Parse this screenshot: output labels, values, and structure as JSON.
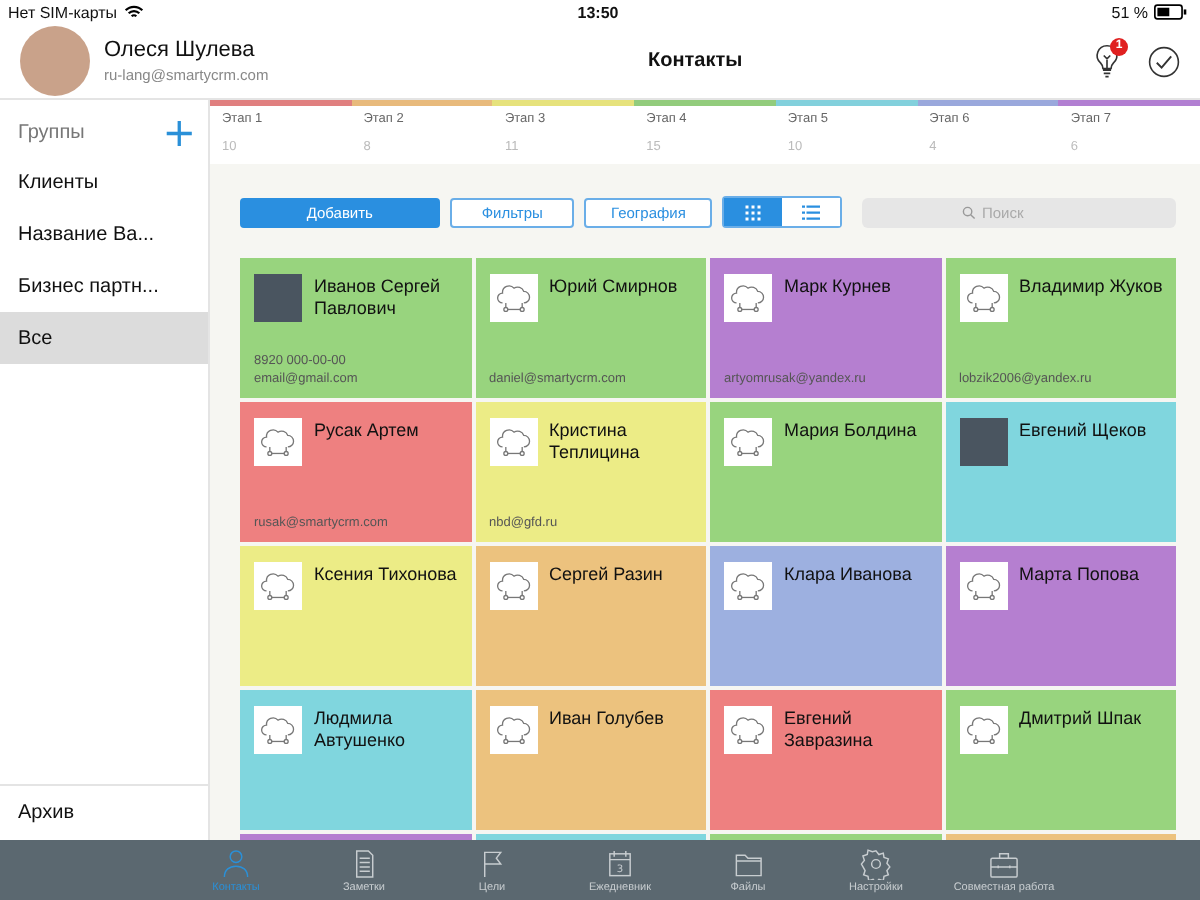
{
  "status_bar": {
    "carrier": "Нет SIM-карты",
    "time": "13:50",
    "battery": "51 %"
  },
  "header": {
    "user_name": "Олеся Шулева",
    "user_email": "ru-lang@smartycrm.com",
    "title": "Контакты",
    "notification_count": "1"
  },
  "sidebar": {
    "heading": "Группы",
    "add_label": "+",
    "items": [
      {
        "label": "Клиенты",
        "selected": false
      },
      {
        "label": "Название Ва...",
        "selected": false
      },
      {
        "label": "Бизнес партн...",
        "selected": false
      },
      {
        "label": "Все",
        "selected": true
      }
    ],
    "footer": "Архив"
  },
  "stages": [
    {
      "name": "Этап 1",
      "count": "10",
      "color": "#e07f7f"
    },
    {
      "name": "Этап 2",
      "count": "8",
      "color": "#e8ba7c"
    },
    {
      "name": "Этап 3",
      "count": "11",
      "color": "#e6e27c"
    },
    {
      "name": "Этап 4",
      "count": "15",
      "color": "#92cc7c"
    },
    {
      "name": "Этап 5",
      "count": "10",
      "color": "#82d0dc"
    },
    {
      "name": "Этап 6",
      "count": "4",
      "color": "#9aa8dc"
    },
    {
      "name": "Этап 7",
      "count": "6",
      "color": "#b27fd2"
    }
  ],
  "toolbar": {
    "add": "Добавить",
    "filters": "Фильтры",
    "geography": "География",
    "view_toggle": [
      {
        "kind": "grid",
        "selected": true
      },
      {
        "kind": "list",
        "selected": false
      }
    ],
    "search_placeholder": "Поиск"
  },
  "contacts": [
    {
      "name": "Иванов Сергей Павлович",
      "kind": "photo",
      "color": "#98d47e",
      "phone": "8920 000-00-00",
      "email": "email@gmail.com"
    },
    {
      "name": "Юрий Смирнов",
      "kind": "placeholder",
      "color": "#98d47e",
      "email": "daniel@smartycrm.com"
    },
    {
      "name": "Марк Курнев",
      "kind": "placeholder",
      "color": "#b57fd0",
      "email": "artyomrusak@yandex.ru"
    },
    {
      "name": "Владимир Жуков",
      "kind": "placeholder",
      "color": "#98d47e",
      "email": "lobzik2006@yandex.ru"
    },
    {
      "name": "Русак Артем",
      "kind": "placeholder",
      "color": "#ee8080",
      "email": "rusak@smartycrm.com"
    },
    {
      "name": "Кристина Теплицина",
      "kind": "placeholder",
      "color": "#ecec86",
      "email": "nbd@gfd.ru"
    },
    {
      "name": "Мария Болдина",
      "kind": "placeholder",
      "color": "#98d47e"
    },
    {
      "name": "Евгений Щеков",
      "kind": "photo",
      "color": "#80d6de"
    },
    {
      "name": "Ксения Тихонова",
      "kind": "placeholder",
      "color": "#ecec86"
    },
    {
      "name": "Сергей Разин",
      "kind": "placeholder",
      "color": "#ecc27e"
    },
    {
      "name": "Клара Иванова",
      "kind": "placeholder",
      "color": "#9db0e0"
    },
    {
      "name": "Марта Попова",
      "kind": "placeholder",
      "color": "#b57fd0"
    },
    {
      "name": "Людмила Автушенко",
      "kind": "placeholder",
      "color": "#80d6de"
    },
    {
      "name": "Иван Голубев",
      "kind": "placeholder",
      "color": "#ecc27e"
    },
    {
      "name": "Евгений Завразина",
      "kind": "placeholder",
      "color": "#ee8080"
    },
    {
      "name": "Дмитрий Шпак",
      "kind": "placeholder",
      "color": "#98d47e"
    },
    {
      "color": "#b57fd0"
    },
    {
      "color": "#80d6de"
    },
    {
      "color": "#98d47e"
    },
    {
      "color": "#ecc27e"
    }
  ],
  "tab_bar": [
    {
      "label": "Контакты",
      "kind": "person",
      "selected": true
    },
    {
      "label": "Заметки",
      "kind": "document",
      "selected": false
    },
    {
      "label": "Цели",
      "kind": "flag",
      "selected": false
    },
    {
      "label": "Ежедневник",
      "kind": "calendar",
      "icon_text": "3",
      "selected": false
    },
    {
      "label": "Файлы",
      "kind": "folder",
      "selected": false
    },
    {
      "label": "Настройки",
      "kind": "gear",
      "selected": false
    },
    {
      "label": "Совместная работа",
      "kind": "briefcase",
      "selected": false
    }
  ]
}
